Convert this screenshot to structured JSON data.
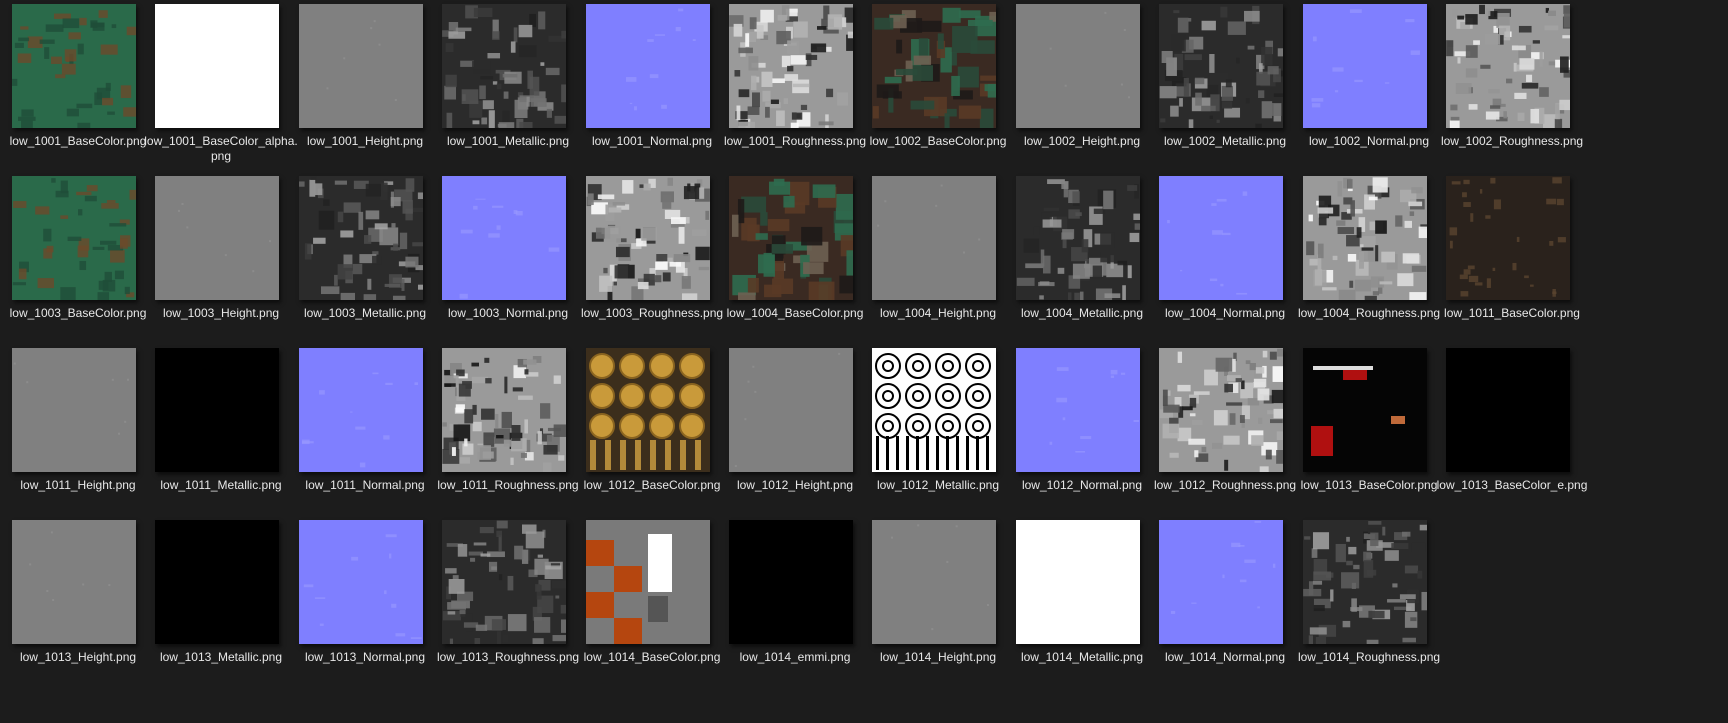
{
  "files": [
    {
      "name": "low_1001_BaseColor.png",
      "look": "green"
    },
    {
      "name": "low_1001_BaseColor_alpha.png",
      "look": "white"
    },
    {
      "name": "low_1001_Height.png",
      "look": "gray"
    },
    {
      "name": "low_1001_Metallic.png",
      "look": "darkgray"
    },
    {
      "name": "low_1001_Normal.png",
      "look": "normal"
    },
    {
      "name": "low_1001_Roughness.png",
      "look": "rough"
    },
    {
      "name": "low_1002_BaseColor.png",
      "look": "mixed"
    },
    {
      "name": "low_1002_Height.png",
      "look": "gray"
    },
    {
      "name": "low_1002_Metallic.png",
      "look": "darkgray"
    },
    {
      "name": "low_1002_Normal.png",
      "look": "normal"
    },
    {
      "name": "low_1002_Roughness.png",
      "look": "rough"
    },
    {
      "name": "low_1003_BaseColor.png",
      "look": "green"
    },
    {
      "name": "low_1003_Height.png",
      "look": "gray"
    },
    {
      "name": "low_1003_Metallic.png",
      "look": "darkgray"
    },
    {
      "name": "low_1003_Normal.png",
      "look": "normal"
    },
    {
      "name": "low_1003_Roughness.png",
      "look": "rough"
    },
    {
      "name": "low_1004_BaseColor.png",
      "look": "mixed"
    },
    {
      "name": "low_1004_Height.png",
      "look": "gray"
    },
    {
      "name": "low_1004_Metallic.png",
      "look": "darkgray"
    },
    {
      "name": "low_1004_Normal.png",
      "look": "normal"
    },
    {
      "name": "low_1004_Roughness.png",
      "look": "rough"
    },
    {
      "name": "low_1011_BaseColor.png",
      "look": "brown"
    },
    {
      "name": "low_1011_Height.png",
      "look": "gray"
    },
    {
      "name": "low_1011_Metallic.png",
      "look": "black"
    },
    {
      "name": "low_1011_Normal.png",
      "look": "normal"
    },
    {
      "name": "low_1011_Roughness.png",
      "look": "rough"
    },
    {
      "name": "low_1012_BaseColor.png",
      "look": "gold"
    },
    {
      "name": "low_1012_Height.png",
      "look": "gray"
    },
    {
      "name": "low_1012_Metallic.png",
      "look": "circles"
    },
    {
      "name": "low_1012_Normal.png",
      "look": "normal"
    },
    {
      "name": "low_1012_Roughness.png",
      "look": "rough"
    },
    {
      "name": "low_1013_BaseColor.png",
      "look": "blackred"
    },
    {
      "name": "low_1013_BaseColor_e.png",
      "look": "black"
    },
    {
      "name": "low_1013_Height.png",
      "look": "gray"
    },
    {
      "name": "low_1013_Metallic.png",
      "look": "black"
    },
    {
      "name": "low_1013_Normal.png",
      "look": "normal"
    },
    {
      "name": "low_1013_Roughness.png",
      "look": "darkgray"
    },
    {
      "name": "low_1014_BaseColor.png",
      "look": "checker"
    },
    {
      "name": "low_1014_emmi.png",
      "look": "black"
    },
    {
      "name": "low_1014_Height.png",
      "look": "gray"
    },
    {
      "name": "low_1014_Metallic.png",
      "look": "white"
    },
    {
      "name": "low_1014_Normal.png",
      "look": "normal"
    },
    {
      "name": "low_1014_Roughness.png",
      "look": "darkgray"
    }
  ],
  "colors": {
    "background": "#1c1c1c",
    "label": "#e8e8e8",
    "normal_map": "#7f7fff",
    "height_gray": "#808080",
    "green_base": "#2a6a4a"
  }
}
